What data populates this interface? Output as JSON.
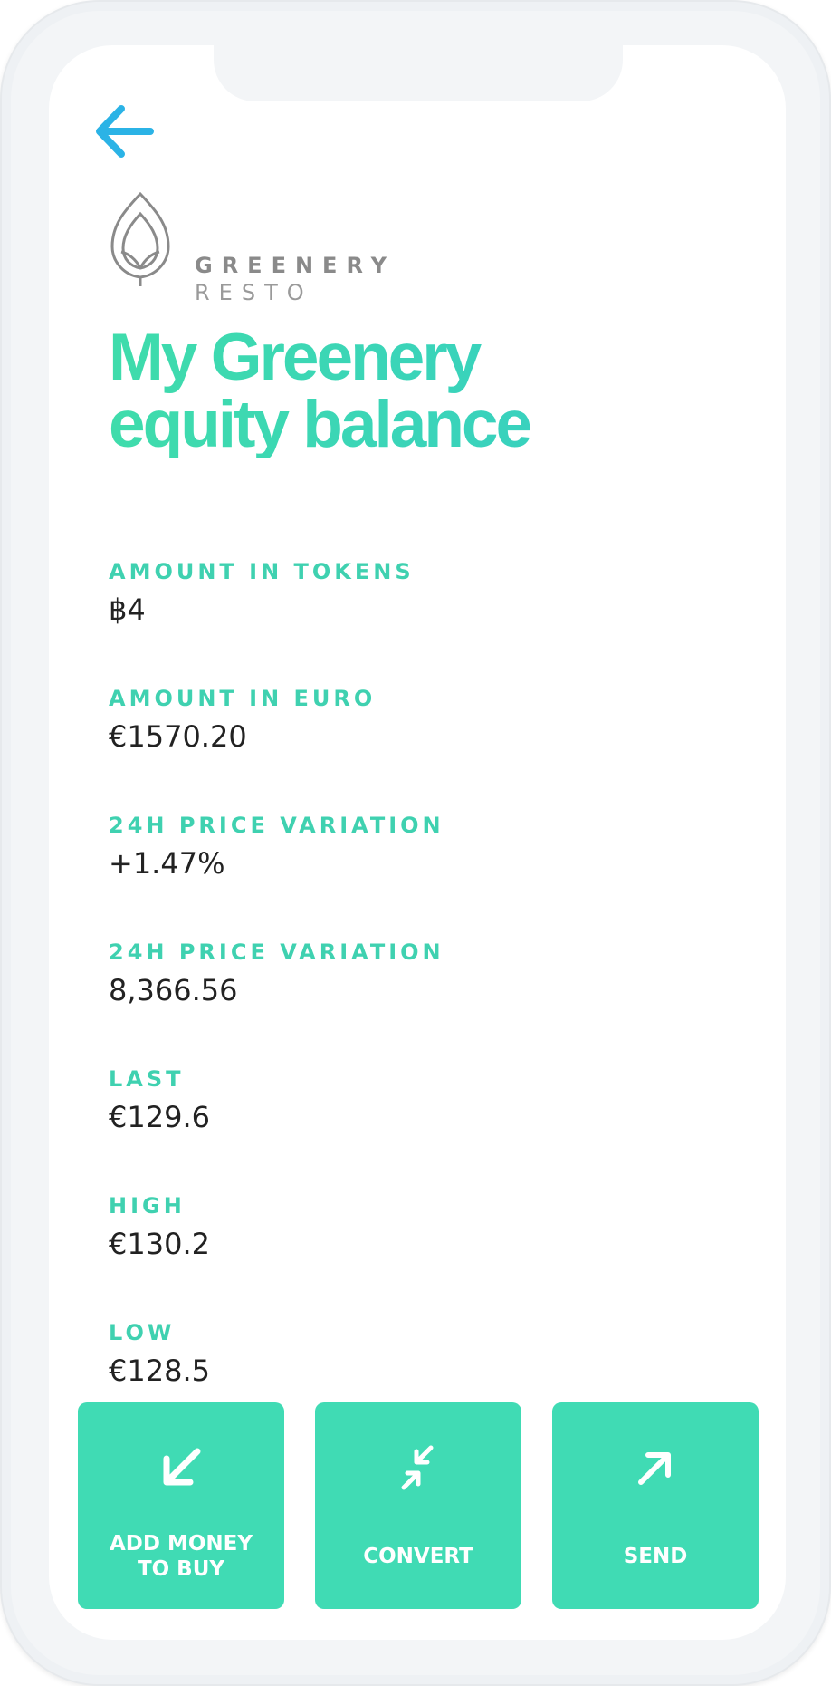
{
  "header": {
    "back_icon": "arrow-left-icon",
    "logo": {
      "line1": "GREENERY",
      "line2": "RESTO",
      "icon": "leaf-icon"
    }
  },
  "title": {
    "line1": "My Greenery",
    "line2": "equity balance"
  },
  "stats": [
    {
      "label": "AMOUNT IN TOKENS",
      "value": "฿4"
    },
    {
      "label": "AMOUNT IN EURO",
      "value": "€1570.20"
    },
    {
      "label": "24H PRICE VARIATION",
      "value": "+1.47%"
    },
    {
      "label": "24H PRICE VARIATION",
      "value": "8,366.56"
    },
    {
      "label": "LAST",
      "value": "€129.6"
    },
    {
      "label": "HIGH",
      "value": "€130.2"
    },
    {
      "label": "LOW",
      "value": "€128.5"
    }
  ],
  "actions": [
    {
      "label": "ADD MONEY\nTO BUY",
      "icon": "arrow-down-left-icon"
    },
    {
      "label": "CONVERT",
      "icon": "convert-arrows-icon"
    },
    {
      "label": "SEND",
      "icon": "arrow-up-right-icon"
    }
  ],
  "colors": {
    "accent": "#40dbb4",
    "back_arrow": "#2bb3e6",
    "text": "#222222"
  }
}
